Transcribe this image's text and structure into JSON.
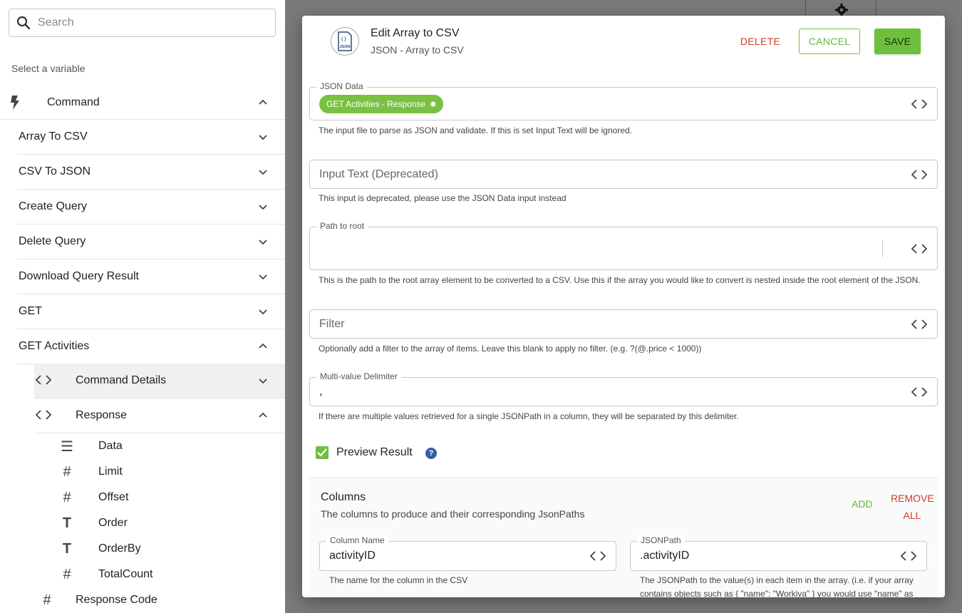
{
  "sidebar": {
    "search_placeholder": "Search",
    "select_label": "Select a variable",
    "command_label": "Command",
    "items": [
      {
        "label": "Array To CSV"
      },
      {
        "label": "CSV To JSON"
      },
      {
        "label": "Create Query"
      },
      {
        "label": "Delete Query"
      },
      {
        "label": "Download Query Result"
      },
      {
        "label": "GET"
      },
      {
        "label": "GET Activities"
      }
    ],
    "sub_items": [
      {
        "label": "Command Details",
        "icon": "code-icon"
      },
      {
        "label": "Response",
        "icon": "code-icon"
      }
    ],
    "leaves": [
      {
        "label": "Data",
        "icon": "list-icon",
        "glyph": "☰"
      },
      {
        "label": "Limit",
        "icon": "hash-icon",
        "glyph": "#"
      },
      {
        "label": "Offset",
        "icon": "hash-icon",
        "glyph": "#"
      },
      {
        "label": "Order",
        "icon": "text-type-icon",
        "glyph": "T"
      },
      {
        "label": "OrderBy",
        "icon": "text-type-icon",
        "glyph": "T"
      },
      {
        "label": "TotalCount",
        "icon": "hash-icon",
        "glyph": "#"
      }
    ],
    "response_code": {
      "label": "Response Code",
      "glyph": "#"
    }
  },
  "modal": {
    "title": "Edit Array to CSV",
    "subtitle": "JSON - Array to CSV",
    "logo_text": "JSON",
    "delete_label": "DELETE",
    "cancel_label": "CANCEL",
    "save_label": "SAVE",
    "json_data": {
      "legend": "JSON Data",
      "pill": "GET Activities - Response",
      "helper": "The input file to parse as JSON and validate. If this is set Input Text will be ignored."
    },
    "input_text": {
      "placeholder": "Input Text (Deprecated)",
      "helper": "This input is deprecated, please use the JSON Data input instead"
    },
    "path_to_root": {
      "legend": "Path to root",
      "helper": "This is the path to the root array element to be converted to a CSV. Use this if the array you would like to convert is nested inside the root element of the JSON."
    },
    "filter": {
      "placeholder": "Filter",
      "helper": "Optionally add a filter to the array of items. Leave this blank to apply no filter. (e.g. ?(@.price < 1000))"
    },
    "delimiter": {
      "legend": "Multi-value Delimiter",
      "value": ",",
      "helper": "If there are multiple values retrieved for a single JSONPath in a column, they will be separated by this delimiter."
    },
    "preview": {
      "label": "Preview Result",
      "checked": true,
      "help_glyph": "?"
    },
    "columns": {
      "title": "Columns",
      "description": "The columns to produce and their corresponding JsonPaths",
      "add_label": "ADD",
      "remove_label_1": "REMOVE",
      "remove_label_2": "ALL",
      "column_name": {
        "legend": "Column Name",
        "value": "activityID",
        "helper": "The name for the column in the CSV"
      },
      "json_path": {
        "legend": "JSONPath",
        "value": ".activityID",
        "helper_1": "The JSONPath to the value(s) in each item in the array. (i.e. if your array",
        "helper_2": "contains objects such as { \"name\": \"Workiva\" } you would use \"name\" as the"
      }
    }
  },
  "colors": {
    "accent_green": "#6fbf3f",
    "danger_red": "#d03a2f",
    "help_blue": "#3b5ba6"
  }
}
